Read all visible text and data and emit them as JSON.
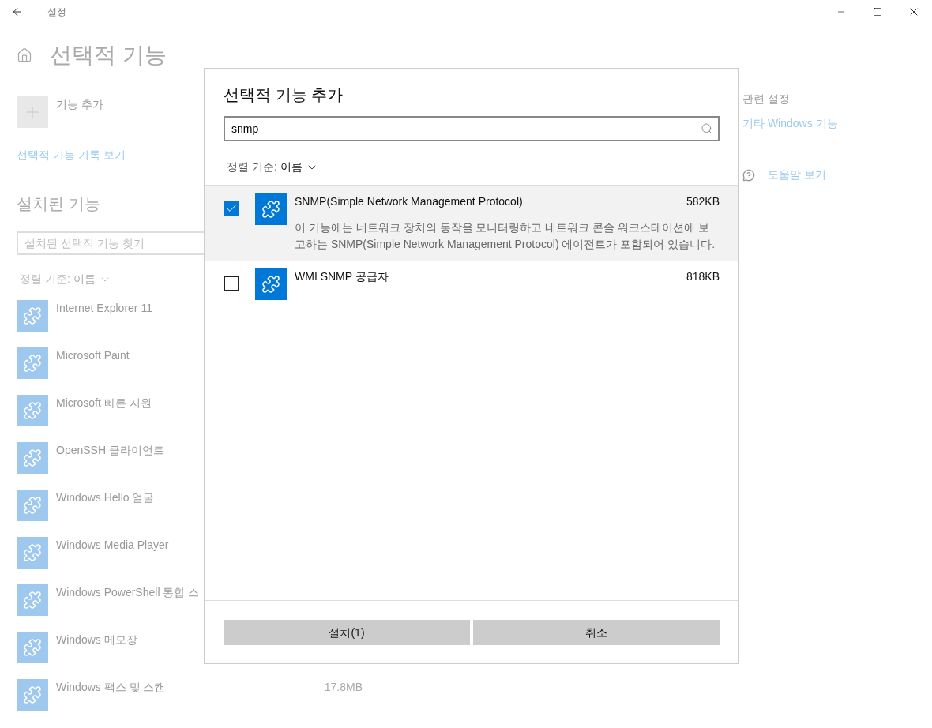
{
  "window": {
    "title": "설정"
  },
  "page": {
    "title": "선택적 기능",
    "add_feature": "기능 추가",
    "history_link": "선택적 기능 기록 보기",
    "installed_heading": "설치된 기능",
    "search": {
      "placeholder": "설치된 선택적 기능 찾기"
    },
    "sort": {
      "label": "정렬 기준:",
      "value": "이름"
    },
    "features": [
      {
        "name": "Internet Explorer 11"
      },
      {
        "name": "Microsoft Paint"
      },
      {
        "name": "Microsoft 빠른 지원"
      },
      {
        "name": "OpenSSH 클라이언트"
      },
      {
        "name": "Windows Hello 얼굴"
      },
      {
        "name": "Windows Media Player"
      },
      {
        "name": "Windows PowerShell 통합 스"
      },
      {
        "name": "Windows 메모장"
      },
      {
        "name": "Windows 팩스 및 스캔",
        "size": "17.8MB"
      }
    ]
  },
  "related": {
    "heading": "관련 설정",
    "link": "기타 Windows 기능",
    "help": "도움말 보기"
  },
  "dialog": {
    "title": "선택적 기능 추가",
    "search": {
      "value": "snmp"
    },
    "sort": {
      "label": "정렬 기준:",
      "value": "이름"
    },
    "items": [
      {
        "name": "SNMP(Simple Network Management Protocol)",
        "size": "582KB",
        "description": "이 기능에는 네트워크 장치의 동작을 모니터링하고 네트워크 콘솔 워크스테이션에 보고하는 SNMP(Simple Network Management Protocol) 에이전트가 포함되어 있습니다.",
        "checked": true,
        "selected": true
      },
      {
        "name": "WMI SNMP 공급자",
        "size": "818KB",
        "checked": false,
        "selected": false
      }
    ],
    "buttons": [
      "설치(1)",
      "취소"
    ]
  }
}
